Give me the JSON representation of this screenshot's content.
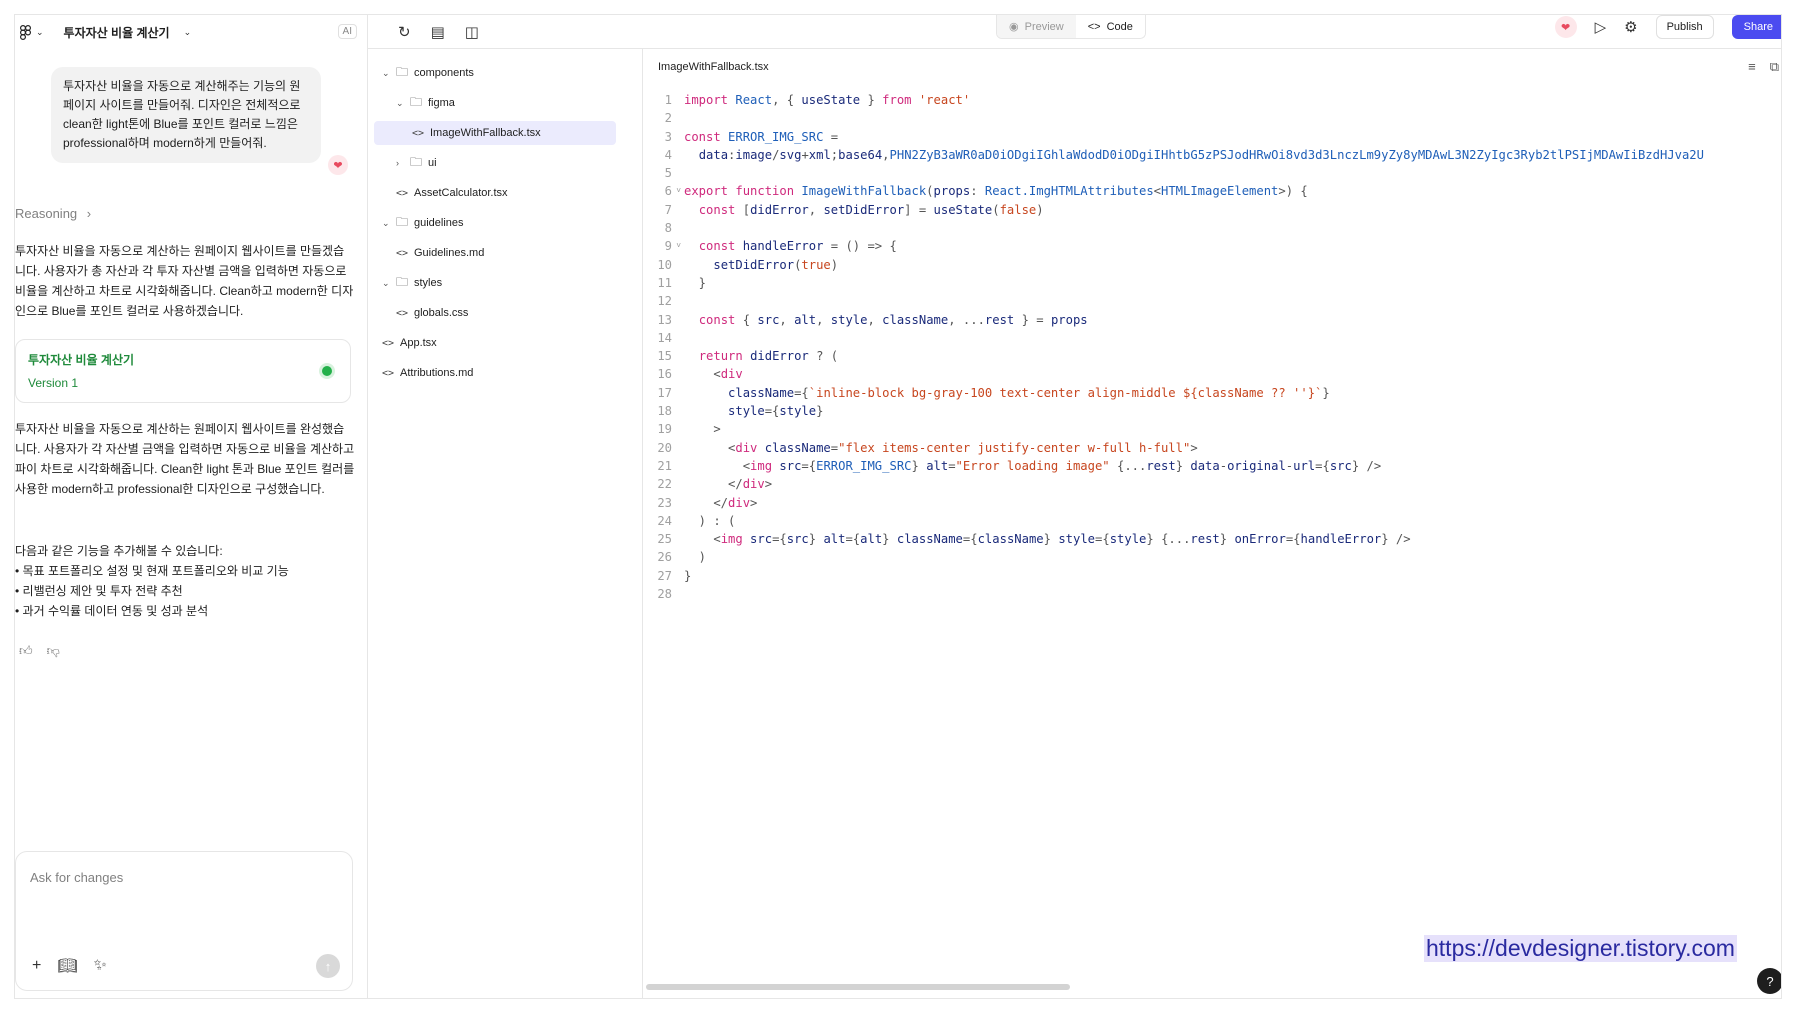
{
  "header": {
    "project_title": "투자자산 비율 계산기",
    "ai_badge": "AI"
  },
  "chat": {
    "user_message": "투자자산 비율을 자동으로 계산해주는 기능의 원페이지 사이트를 만들어줘. 디자인은 전체적으로 clean한 light톤에 Blue를 포인트 컬러로 느낌은 professional하며 modern하게 만들어줘.",
    "reasoning_label": "Reasoning",
    "reply_1": "투자자산 비율을 자동으로 계산하는 원페이지 웹사이트를 만들겠습니다. 사용자가 총 자산과 각 투자 자산별 금액을 입력하면 자동으로 비율을 계산하고 차트로 시각화해줍니다. Clean하고 modern한 디자인으로 Blue를 포인트 컬러로 사용하겠습니다.",
    "version_card": {
      "title": "투자자산 비율 계산기",
      "version": "Version 1"
    },
    "reply_2": "투자자산 비율을 자동으로 계산하는 원페이지 웹사이트를 완성했습니다. 사용자가 각 자산별 금액을 입력하면 자동으로 비율을 계산하고 파이 차트로 시각화해줍니다. Clean한 light 톤과 Blue 포인트 컬러를 사용한 modern하고 professional한 디자인으로 구성했습니다.",
    "suggestions_intro": "다음과 같은 기능을 추가해볼 수 있습니다:",
    "suggestions": [
      "• 목표 포트폴리오 설정 및 현재 포트폴리오와 비교 기능",
      "• 리밸런싱 제안 및 투자 전략 추천",
      "• 과거 수익률 데이터 연동 및 성과 분석"
    ],
    "composer_placeholder": "Ask for changes"
  },
  "toolbar": {
    "preview_label": "Preview",
    "code_label": "Code",
    "publish_label": "Publish",
    "share_label": "Share"
  },
  "tree": [
    {
      "label": "components",
      "type": "folder",
      "depth": 0,
      "open": true
    },
    {
      "label": "figma",
      "type": "folder",
      "depth": 1,
      "open": true
    },
    {
      "label": "ImageWithFallback.tsx",
      "type": "file",
      "depth": 2,
      "selected": true
    },
    {
      "label": "ui",
      "type": "folder",
      "depth": 1,
      "open": false
    },
    {
      "label": "AssetCalculator.tsx",
      "type": "file",
      "depth": 1
    },
    {
      "label": "guidelines",
      "type": "folder",
      "depth": 0,
      "open": true
    },
    {
      "label": "Guidelines.md",
      "type": "file",
      "depth": 1
    },
    {
      "label": "styles",
      "type": "folder",
      "depth": 0,
      "open": true
    },
    {
      "label": "globals.css",
      "type": "file",
      "depth": 1
    },
    {
      "label": "App.tsx",
      "type": "file",
      "depth": 0
    },
    {
      "label": "Attributions.md",
      "type": "file",
      "depth": 0
    }
  ],
  "editor": {
    "filename": "ImageWithFallback.tsx",
    "lines": [
      "import React, { useState } from 'react'",
      "",
      "const ERROR_IMG_SRC =",
      "  'data:image/svg+xml;base64,PHN2ZyB3aWR0aD0iODgiIGhlaWdodD0iODgiIHhtbG5zPSJodHRwOi8vd3d3LnczLm9yZy8yMDAwL3N2ZyIgc3Ryb2tlPSIjMDAwIiBzdHJva2U",
      "",
      "export function ImageWithFallback(props: React.ImgHTMLAttributes<HTMLImageElement>) {",
      "  const [didError, setDidError] = useState(false)",
      "",
      "  const handleError = () => {",
      "    setDidError(true)",
      "  }",
      "",
      "  const { src, alt, style, className, ...rest } = props",
      "",
      "  return didError ? (",
      "    <div",
      "      className={`inline-block bg-gray-100 text-center align-middle ${className ?? ''}`}",
      "      style={style}",
      "    >",
      "      <div className=\"flex items-center justify-center w-full h-full\">",
      "        <img src={ERROR_IMG_SRC} alt=\"Error loading image\" {...rest} data-original-url={src} />",
      "      </div>",
      "    </div>",
      "  ) : (",
      "    <img src={src} alt={alt} className={className} style={style} {...rest} onError={handleError} />",
      "  )",
      "}",
      ""
    ]
  },
  "watermark": "https://devdesigner.tistory.com",
  "help_label": "?"
}
